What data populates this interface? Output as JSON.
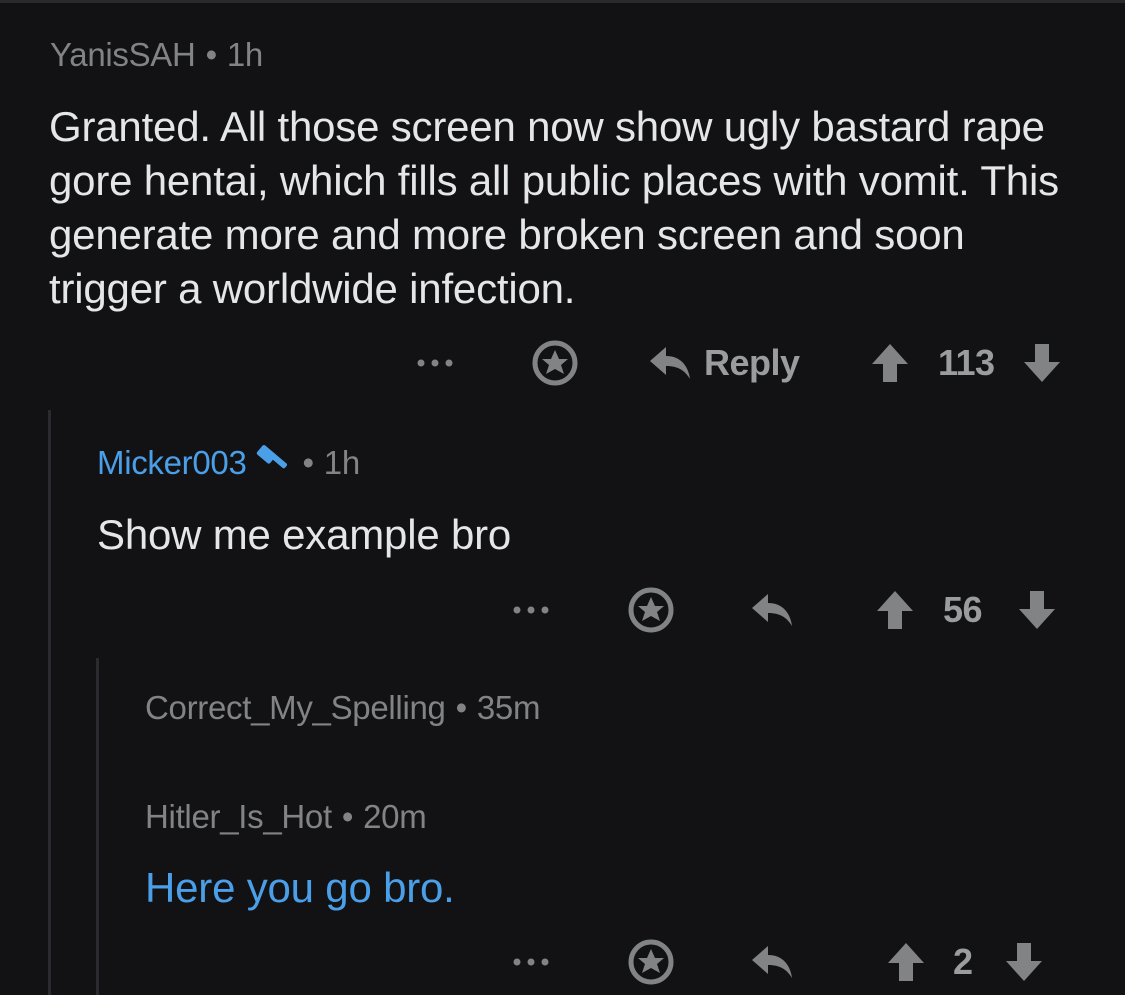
{
  "comments": [
    {
      "username": "YanisSAH",
      "separator": "•",
      "time": "1h",
      "body": "Granted. All those screen now show ugly bastard rape gore hentai, which fills all public places with vomit. This generate more and more broken screen and soon trigger a worldwide infection.",
      "reply_label": "Reply",
      "votes": "113"
    },
    {
      "username": "Micker003",
      "separator": "•",
      "time": "1h",
      "body": "Show me example bro",
      "votes": "56"
    },
    {
      "username": "Correct_My_Spelling",
      "separator": "•",
      "time": "35m"
    },
    {
      "username": "Hitler_Is_Hot",
      "separator": "•",
      "time": "20m",
      "body": "Here you go bro.",
      "votes": "2"
    }
  ],
  "icons": {
    "more": "more-options-icon",
    "award": "award-icon",
    "reply": "reply-arrow-icon",
    "upvote": "upvote-arrow-icon",
    "downvote": "downvote-arrow-icon",
    "mod": "hammer-icon"
  },
  "colors": {
    "background": "#121214",
    "meta": "#818384",
    "text": "#e4e6e7",
    "link": "#4a9fe8",
    "thread_line": "#2b2b2f"
  }
}
